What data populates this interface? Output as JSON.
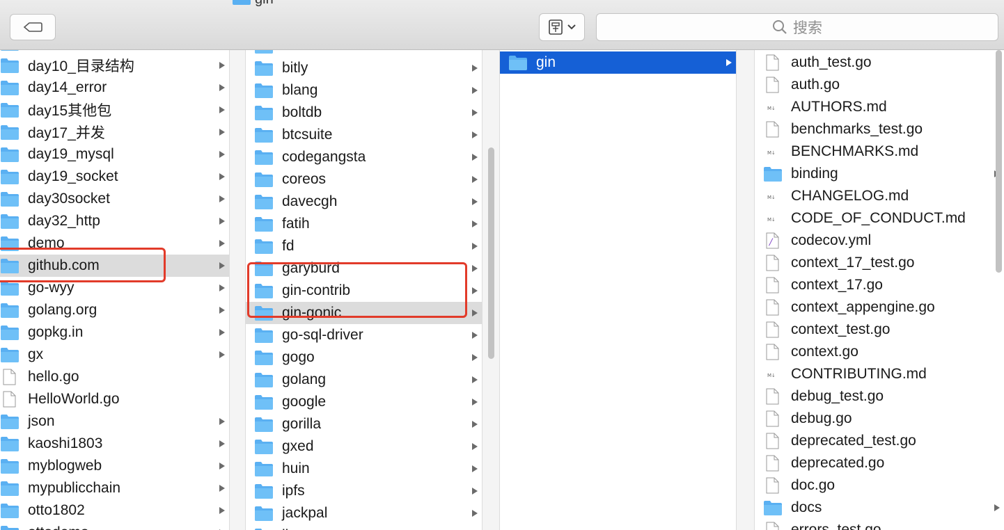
{
  "window": {
    "title": "gin"
  },
  "toolbar": {
    "back_icon": "back-arrow-icon",
    "view_icon": "view-options-icon",
    "search_placeholder": "搜索"
  },
  "colors": {
    "folder": "#5ab0f2",
    "selection_blue": "#1560d6",
    "selection_gray": "#dcdcdc",
    "highlight_red": "#e23b2a"
  },
  "column1": {
    "items": [
      {
        "label": "",
        "type": "folder"
      },
      {
        "label": "day10_目录结构",
        "type": "folder"
      },
      {
        "label": "day14_error",
        "type": "folder"
      },
      {
        "label": "day15其他包",
        "type": "folder"
      },
      {
        "label": "day17_并发",
        "type": "folder"
      },
      {
        "label": "day19_mysql",
        "type": "folder"
      },
      {
        "label": "day19_socket",
        "type": "folder"
      },
      {
        "label": "day30socket",
        "type": "folder"
      },
      {
        "label": "day32_http",
        "type": "folder"
      },
      {
        "label": "demo",
        "type": "folder"
      },
      {
        "label": "github.com",
        "type": "folder",
        "selected": true
      },
      {
        "label": "go-wyy",
        "type": "folder"
      },
      {
        "label": "golang.org",
        "type": "folder"
      },
      {
        "label": "gopkg.in",
        "type": "folder"
      },
      {
        "label": "gx",
        "type": "folder"
      },
      {
        "label": "hello.go",
        "type": "file"
      },
      {
        "label": "HelloWorld.go",
        "type": "file"
      },
      {
        "label": "json",
        "type": "folder"
      },
      {
        "label": "kaoshi1803",
        "type": "folder"
      },
      {
        "label": "myblogweb",
        "type": "folder"
      },
      {
        "label": "mypublicchain",
        "type": "folder"
      },
      {
        "label": "otto1802",
        "type": "folder"
      },
      {
        "label": "ottodemo",
        "type": "folder"
      }
    ]
  },
  "column2": {
    "items": [
      {
        "label": "",
        "type": "folder"
      },
      {
        "label": "bitly",
        "type": "folder"
      },
      {
        "label": "blang",
        "type": "folder"
      },
      {
        "label": "boltdb",
        "type": "folder"
      },
      {
        "label": "btcsuite",
        "type": "folder"
      },
      {
        "label": "codegangsta",
        "type": "folder"
      },
      {
        "label": "coreos",
        "type": "folder"
      },
      {
        "label": "davecgh",
        "type": "folder"
      },
      {
        "label": "fatih",
        "type": "folder"
      },
      {
        "label": "fd",
        "type": "folder"
      },
      {
        "label": "garyburd",
        "type": "folder"
      },
      {
        "label": "gin-contrib",
        "type": "folder"
      },
      {
        "label": "gin-gonic",
        "type": "folder",
        "selected": true
      },
      {
        "label": "go-sql-driver",
        "type": "folder"
      },
      {
        "label": "gogo",
        "type": "folder"
      },
      {
        "label": "golang",
        "type": "folder"
      },
      {
        "label": "google",
        "type": "folder"
      },
      {
        "label": "gorilla",
        "type": "folder"
      },
      {
        "label": "gxed",
        "type": "folder"
      },
      {
        "label": "huin",
        "type": "folder"
      },
      {
        "label": "ipfs",
        "type": "folder"
      },
      {
        "label": "jackpal",
        "type": "folder"
      },
      {
        "label": "jbenet",
        "type": "folder"
      }
    ]
  },
  "column3": {
    "items": [
      {
        "label": "gin",
        "type": "folder",
        "selected": true
      }
    ]
  },
  "column4": {
    "items": [
      {
        "label": "auth_test.go",
        "type": "file"
      },
      {
        "label": "auth.go",
        "type": "file"
      },
      {
        "label": "AUTHORS.md",
        "type": "md"
      },
      {
        "label": "benchmarks_test.go",
        "type": "file"
      },
      {
        "label": "BENCHMARKS.md",
        "type": "md"
      },
      {
        "label": "binding",
        "type": "folder"
      },
      {
        "label": "CHANGELOG.md",
        "type": "md"
      },
      {
        "label": "CODE_OF_CONDUCT.md",
        "type": "md"
      },
      {
        "label": "codecov.yml",
        "type": "yml"
      },
      {
        "label": "context_17_test.go",
        "type": "file"
      },
      {
        "label": "context_17.go",
        "type": "file"
      },
      {
        "label": "context_appengine.go",
        "type": "file"
      },
      {
        "label": "context_test.go",
        "type": "file"
      },
      {
        "label": "context.go",
        "type": "file"
      },
      {
        "label": "CONTRIBUTING.md",
        "type": "md"
      },
      {
        "label": "debug_test.go",
        "type": "file"
      },
      {
        "label": "debug.go",
        "type": "file"
      },
      {
        "label": "deprecated_test.go",
        "type": "file"
      },
      {
        "label": "deprecated.go",
        "type": "file"
      },
      {
        "label": "doc.go",
        "type": "file"
      },
      {
        "label": "docs",
        "type": "folder"
      },
      {
        "label": "errors_test.go",
        "type": "file"
      }
    ]
  }
}
